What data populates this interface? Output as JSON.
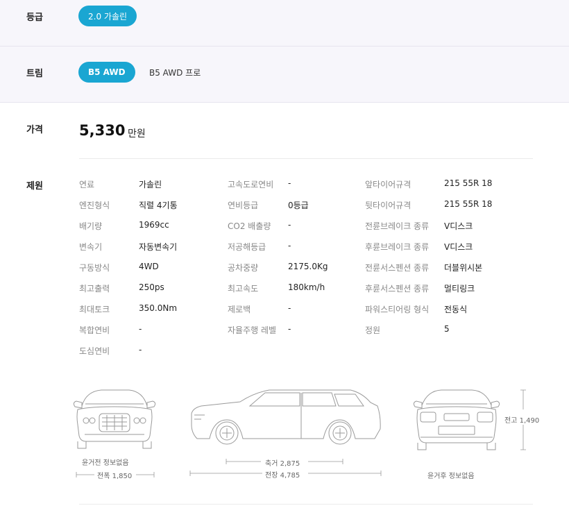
{
  "grade": {
    "label": "등급",
    "options": [
      {
        "label": "2.0 가솔린",
        "active": true
      }
    ]
  },
  "trim": {
    "label": "트림",
    "options": [
      {
        "label": "B5 AWD",
        "active": true
      },
      {
        "label": "B5 AWD 프로",
        "active": false
      }
    ]
  },
  "price": {
    "label": "가격",
    "value": "5,330",
    "unit": "만원"
  },
  "specs": {
    "label": "제원",
    "columns": [
      [
        {
          "key": "연료",
          "value": "가솔린"
        },
        {
          "key": "엔진형식",
          "value": "직렬 4기통"
        },
        {
          "key": "배기량",
          "value": "1969cc"
        },
        {
          "key": "변속기",
          "value": "자동변속기"
        },
        {
          "key": "구동방식",
          "value": "4WD"
        },
        {
          "key": "최고출력",
          "value": "250ps"
        },
        {
          "key": "최대토크",
          "value": "350.0Nm"
        },
        {
          "key": "복합연비",
          "value": "-"
        },
        {
          "key": "도심연비",
          "value": "-"
        }
      ],
      [
        {
          "key": "고속도로연비",
          "value": "-"
        },
        {
          "key": "연비등급",
          "value": "0등급"
        },
        {
          "key": "CO2 배출량",
          "value": "-"
        },
        {
          "key": "저공해등급",
          "value": "-"
        },
        {
          "key": "공차중량",
          "value": "2175.0Kg"
        },
        {
          "key": "최고속도",
          "value": "180km/h"
        },
        {
          "key": "제로백",
          "value": "-"
        },
        {
          "key": "자율주행 레벨",
          "value": "-"
        }
      ],
      [
        {
          "key": "앞타이어규격",
          "value": "215 55R 18"
        },
        {
          "key": "뒷타이어규격",
          "value": "215 55R 18"
        },
        {
          "key": "전륜브레이크 종류",
          "value": "V디스크"
        },
        {
          "key": "후륜브레이크 종류",
          "value": "V디스크"
        },
        {
          "key": "전륜서스펜션 종류",
          "value": "더블위시본"
        },
        {
          "key": "후륜서스펜션 종류",
          "value": "멀티링크"
        },
        {
          "key": "파워스티어링 형식",
          "value": "전동식"
        },
        {
          "key": "정원",
          "value": "5"
        }
      ]
    ]
  },
  "dimensions": {
    "front_track": "윤거전 정보없음",
    "width": "전폭 1,850",
    "wheelbase": "축거 2,875",
    "length": "전장 4,785",
    "rear_track": "윤거후 정보없음",
    "height": "전고 1,490"
  }
}
